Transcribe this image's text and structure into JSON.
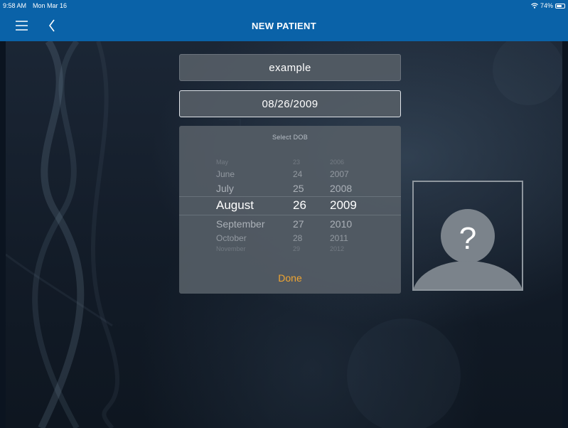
{
  "status_bar": {
    "time": "9:58 AM",
    "date": "Mon Mar 16",
    "battery": "74%",
    "battery_level": 0.74
  },
  "nav": {
    "title": "NEW PATIENT",
    "menu_icon": "hamburger-menu-icon",
    "back_icon": "chevron-left-icon"
  },
  "form": {
    "name_value": "example",
    "dob_value": "08/26/2009"
  },
  "picker": {
    "title": "Select DOB",
    "rows": [
      {
        "month": "May",
        "day": "23",
        "year": "2006"
      },
      {
        "month": "June",
        "day": "24",
        "year": "2007"
      },
      {
        "month": "July",
        "day": "25",
        "year": "2008"
      },
      {
        "month": "August",
        "day": "26",
        "year": "2009"
      },
      {
        "month": "September",
        "day": "27",
        "year": "2010"
      },
      {
        "month": "October",
        "day": "28",
        "year": "2011"
      },
      {
        "month": "November",
        "day": "29",
        "year": "2012"
      }
    ],
    "done_label": "Done"
  },
  "photo": {
    "placeholder_glyph": "?",
    "icon": "avatar-placeholder-icon"
  },
  "colors": {
    "nav_bar": "#0a62a8",
    "done_accent": "#f0a531",
    "field_bg": "#545c65"
  }
}
